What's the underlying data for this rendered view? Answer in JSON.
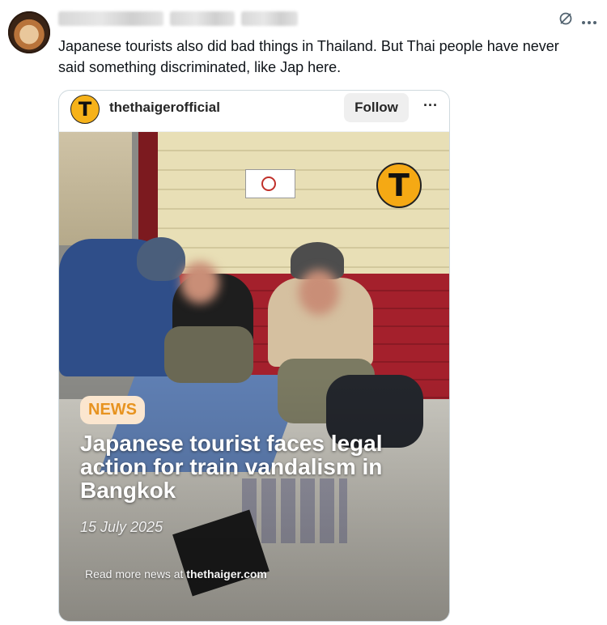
{
  "post": {
    "text": "Japanese tourists also did bad things in Thailand. But Thai people have never said something discriminated, like Jap here."
  },
  "icons": {
    "grok": "grok-icon",
    "more": "more-icon"
  },
  "embed": {
    "account": "thethaigerofficial",
    "avatar_letter": "T",
    "follow_label": "Follow",
    "more_label": "···",
    "badge": "NEWS",
    "headline": "Japanese tourist faces legal action for train vandalism in Bangkok",
    "date": "15 July 2025",
    "footer_prefix": "Read more news at",
    "footer_site": "thethaiger.com",
    "logo_letter": "T"
  },
  "colors": {
    "accent": "#f5a914",
    "badge_text": "#e79320",
    "badge_bg": "#fbe6cf"
  }
}
